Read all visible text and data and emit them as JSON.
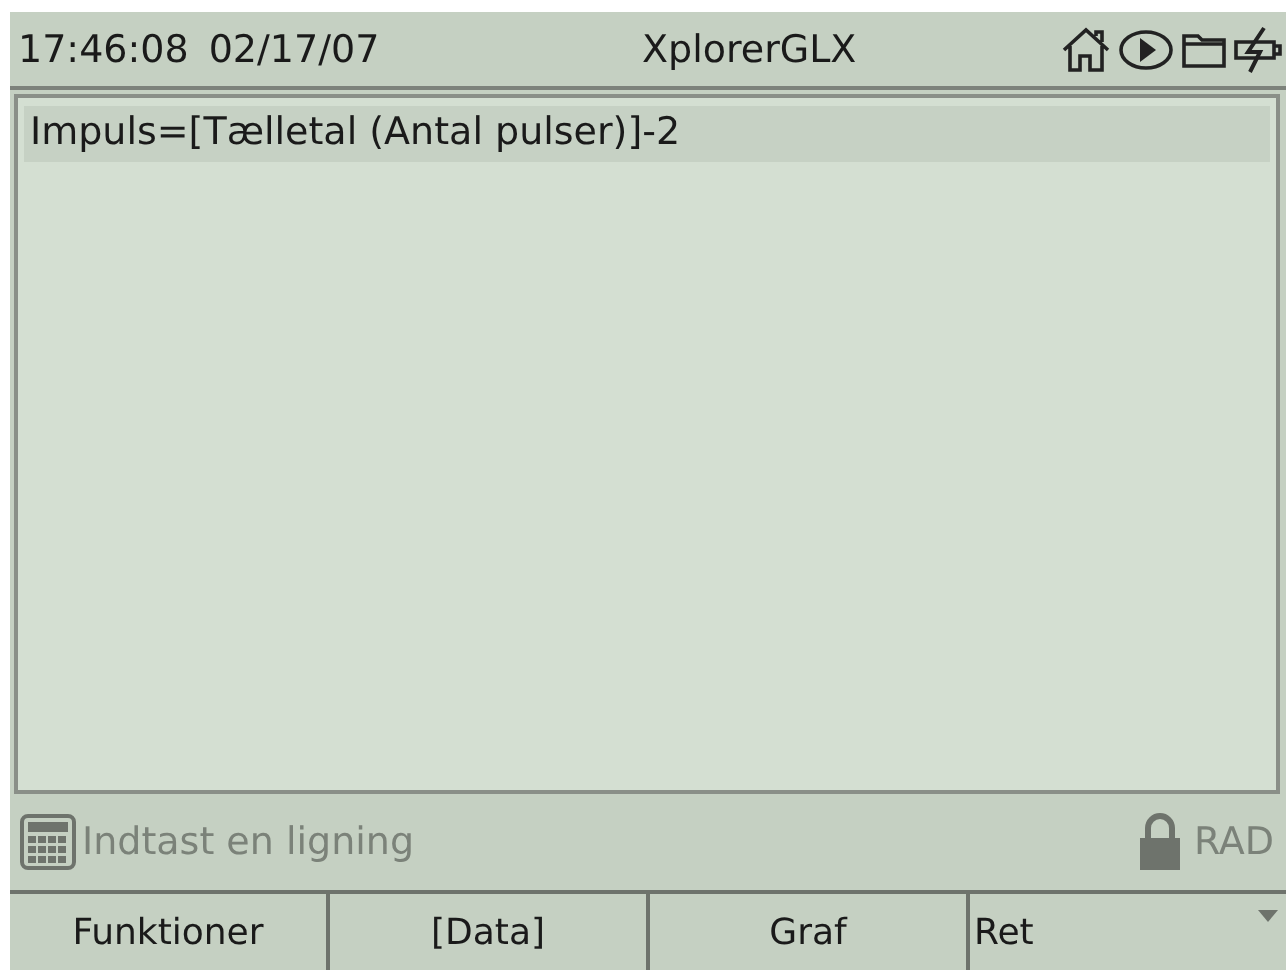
{
  "status_bar": {
    "time": "17:46:08",
    "date": "02/17/07",
    "title": "XplorerGLX"
  },
  "equations": [
    {
      "text": "Impuls=[Tælletal (Antal pulser)]-2",
      "selected": true
    }
  ],
  "hint_bar": {
    "placeholder": "Indtast en ligning",
    "angle_mode": "RAD",
    "locked": true
  },
  "softkeys": [
    {
      "label": "Funktioner",
      "kind": "plain"
    },
    {
      "label": "[Data]",
      "kind": "plain"
    },
    {
      "label": "Graf",
      "kind": "plain"
    },
    {
      "label": "Ret",
      "kind": "menu"
    }
  ]
}
